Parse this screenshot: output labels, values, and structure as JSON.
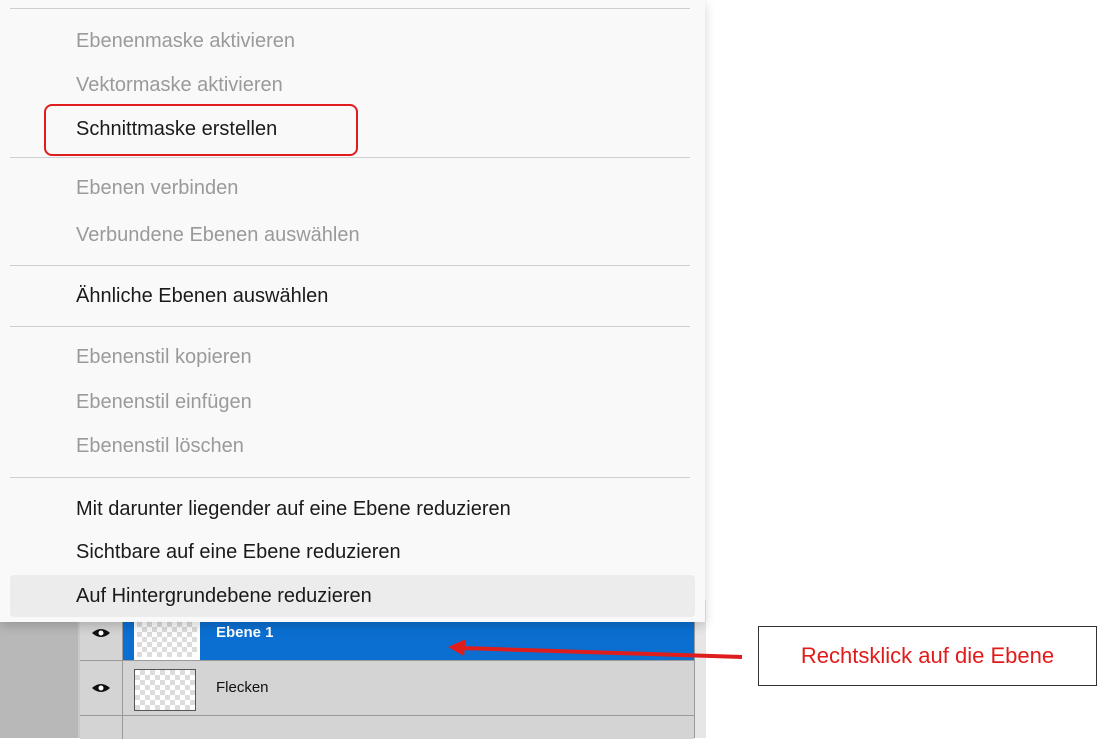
{
  "context_menu": {
    "groups": [
      [
        {
          "label": "Ebenenmaske aktivieren",
          "enabled": false
        },
        {
          "label": "Vektormaske aktivieren",
          "enabled": false
        },
        {
          "label": "Schnittmaske erstellen",
          "enabled": true,
          "highlighted": true
        }
      ],
      [
        {
          "label": "Ebenen verbinden",
          "enabled": false
        },
        {
          "label": "Verbundene Ebenen auswählen",
          "enabled": false
        }
      ],
      [
        {
          "label": "Ähnliche Ebenen auswählen",
          "enabled": true
        }
      ],
      [
        {
          "label": "Ebenenstil kopieren",
          "enabled": false
        },
        {
          "label": "Ebenenstil einfügen",
          "enabled": false
        },
        {
          "label": "Ebenenstil löschen",
          "enabled": false
        }
      ],
      [
        {
          "label": "Mit darunter liegender auf eine Ebene reduzieren",
          "enabled": true
        },
        {
          "label": "Sichtbare auf eine Ebene reduzieren",
          "enabled": true
        },
        {
          "label": "Auf Hintergrundebene reduzieren",
          "enabled": true,
          "hovered": true
        }
      ]
    ]
  },
  "layers": [
    {
      "name": "Ebene 1",
      "selected": true,
      "visible_icon": "eye-icon"
    },
    {
      "name": "Flecken",
      "selected": false,
      "visible_icon": "eye-icon"
    }
  ],
  "annotation": {
    "text": "Rechtsklick auf die Ebene",
    "color": "#e11b1b"
  },
  "colors": {
    "highlight_border": "#e01d1d",
    "selected_layer": "#0a6fd1"
  }
}
